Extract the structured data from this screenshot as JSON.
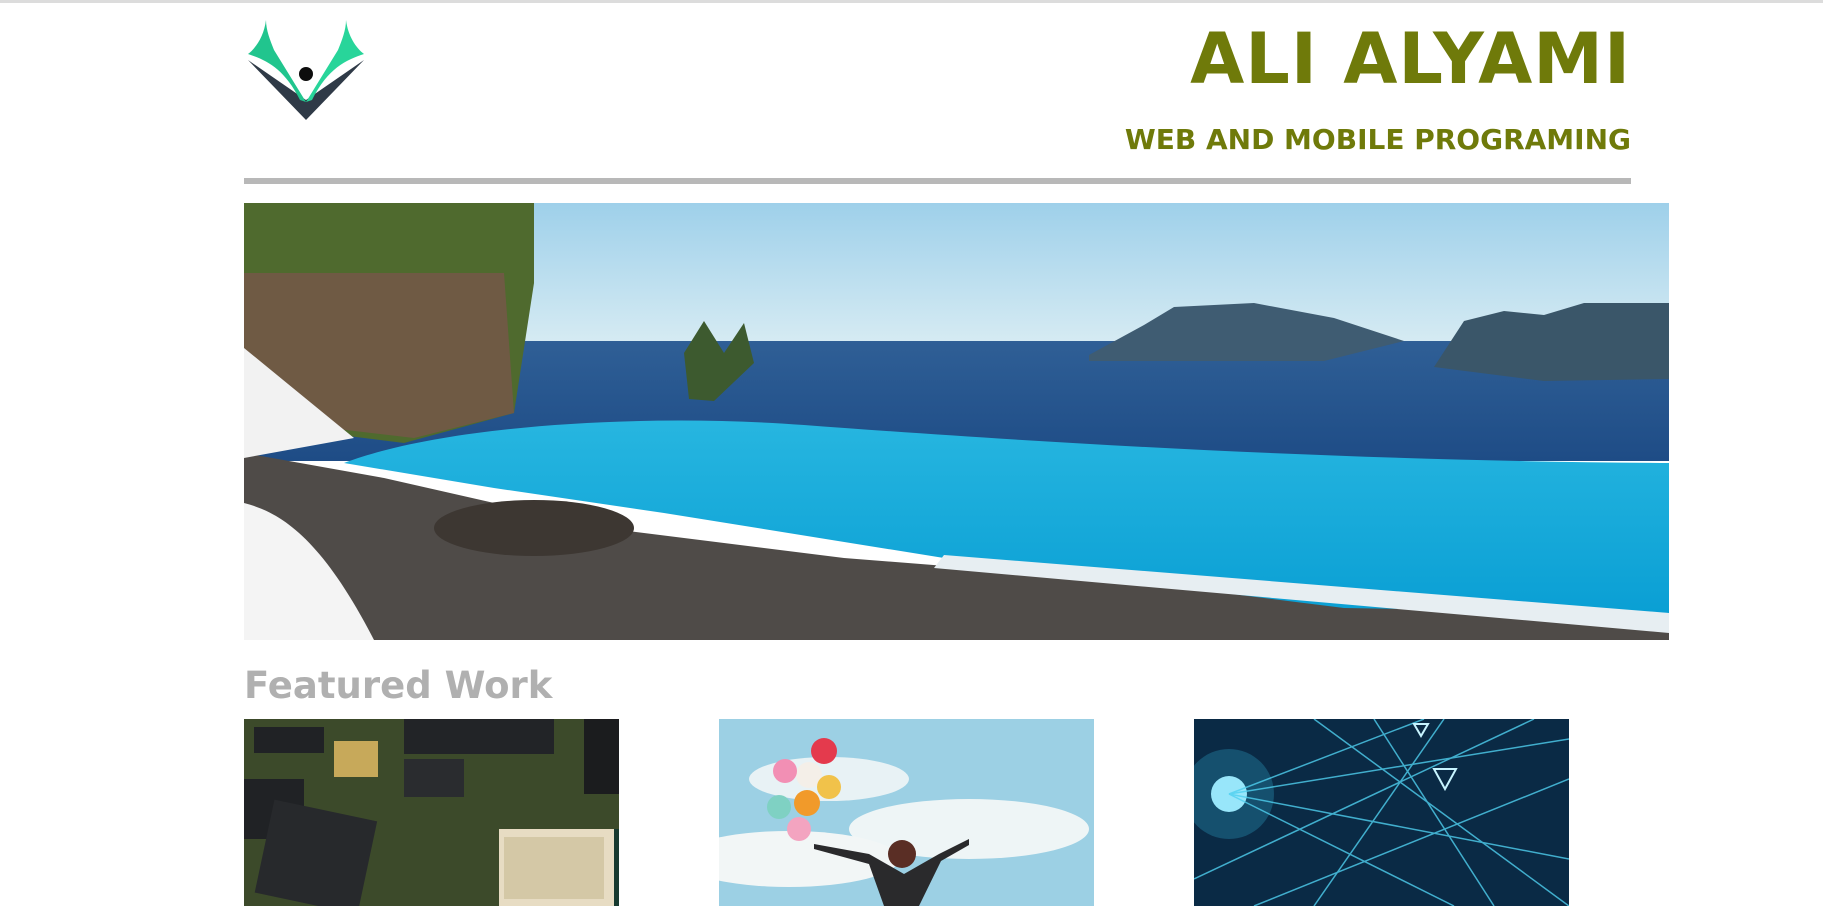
{
  "header": {
    "title": "ALI ALYAMI",
    "subtitle": "WEB AND MOBILE PROGRAMING",
    "logo_icon": "v-person-logo-icon"
  },
  "hero": {
    "image": "infinity-pool-sea-view-image"
  },
  "featured": {
    "heading": "Featured Work",
    "items": [
      {
        "image": "circuit-board-image"
      },
      {
        "image": "person-with-balloons-image"
      },
      {
        "image": "network-lines-image"
      }
    ]
  },
  "colors": {
    "title": "#6f7a0a",
    "divider": "#b8b8b8",
    "featured_heading": "#b0b0b0"
  }
}
